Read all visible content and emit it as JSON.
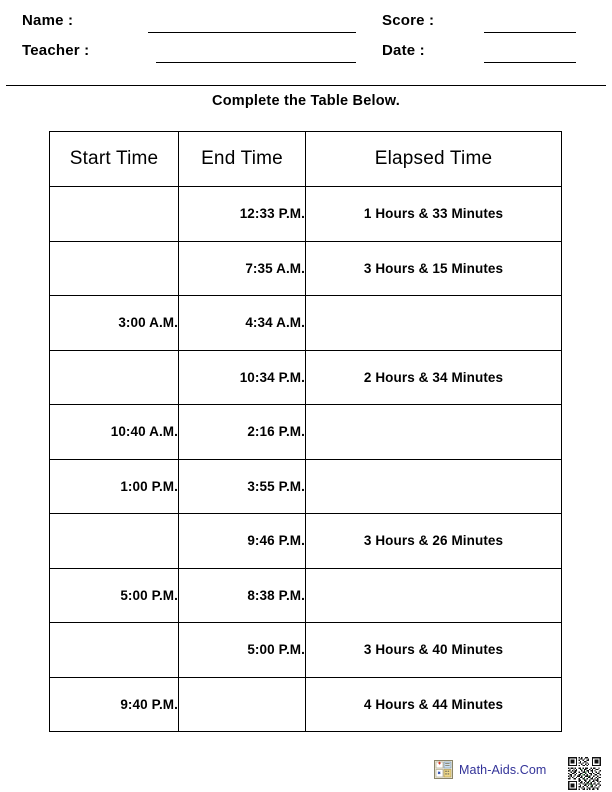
{
  "header": {
    "name_label": "Name :",
    "teacher_label": "Teacher :",
    "score_label": "Score :",
    "date_label": "Date :",
    "name_value": "",
    "teacher_value": "",
    "score_value": "",
    "date_value": ""
  },
  "instruction": "Complete the Table Below.",
  "table": {
    "columns": [
      "Start Time",
      "End Time",
      "Elapsed Time"
    ],
    "rows": [
      {
        "start": "",
        "end": "12:33  P.M.",
        "elapsed": "1  Hours &  33  Minutes"
      },
      {
        "start": "",
        "end": "7:35  A.M.",
        "elapsed": "3  Hours &  15  Minutes"
      },
      {
        "start": "3:00  A.M.",
        "end": "4:34  A.M.",
        "elapsed": ""
      },
      {
        "start": "",
        "end": "10:34  P.M.",
        "elapsed": "2  Hours &  34  Minutes"
      },
      {
        "start": "10:40  A.M.",
        "end": "2:16  P.M.",
        "elapsed": ""
      },
      {
        "start": "1:00  P.M.",
        "end": "3:55  P.M.",
        "elapsed": ""
      },
      {
        "start": "",
        "end": "9:46  P.M.",
        "elapsed": "3  Hours &  26  Minutes"
      },
      {
        "start": "5:00  P.M.",
        "end": "8:38  P.M.",
        "elapsed": ""
      },
      {
        "start": "",
        "end": "5:00  P.M.",
        "elapsed": "3  Hours &  40  Minutes"
      },
      {
        "start": "9:40  P.M.",
        "end": "",
        "elapsed": "4  Hours &  44  Minutes"
      }
    ]
  },
  "footer": {
    "brand_text": "Math-Aids.Com",
    "brand_color": "#333399",
    "calculator_icon": "calculator-icon",
    "qr_icon": "qr-code-icon"
  }
}
